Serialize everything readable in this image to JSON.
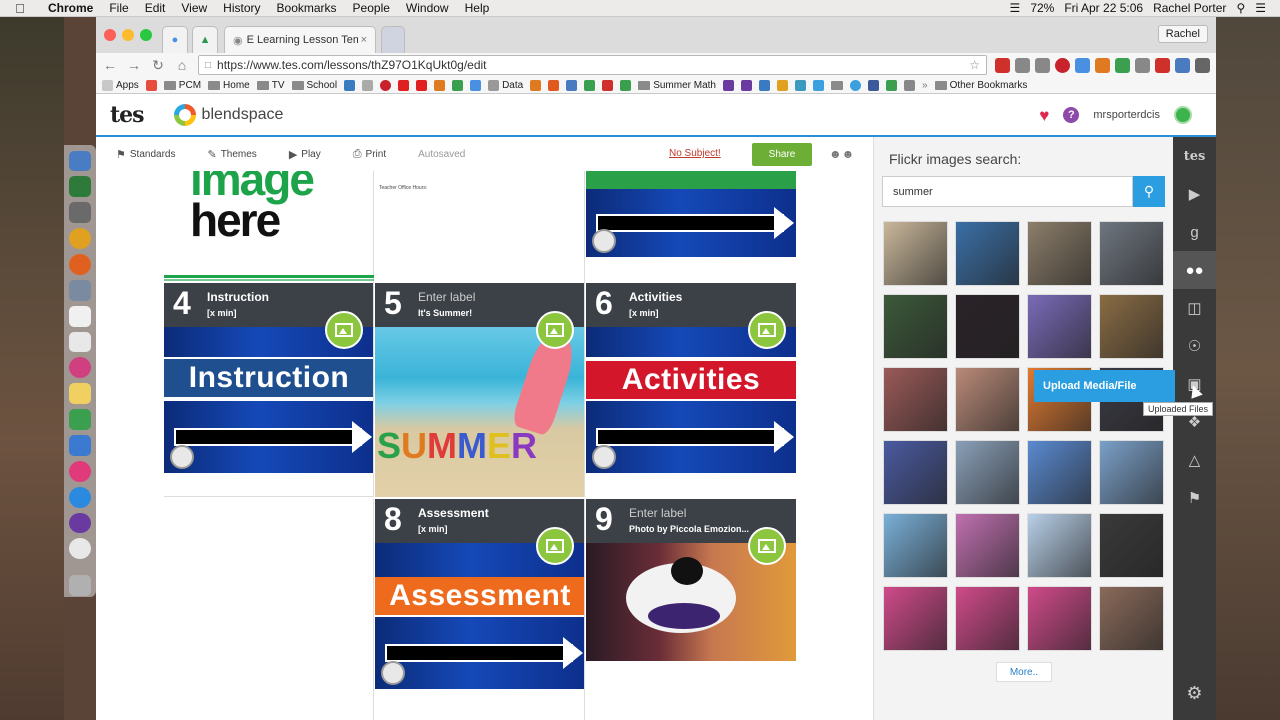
{
  "menubar": {
    "app_name": "Chrome",
    "items": [
      "File",
      "Edit",
      "View",
      "History",
      "Bookmarks",
      "People",
      "Window",
      "Help"
    ],
    "battery": "72%",
    "clock": "Fri Apr 22  5:06",
    "user": "Rachel Porter"
  },
  "browser": {
    "tab_title": "E Learning Lesson Templat",
    "profile": "Rachel",
    "url": "https://www.tes.com/lessons/thZ97O1KqUkt0g/edit",
    "bookmarks": [
      {
        "label": "Apps",
        "kind": "apps"
      },
      {
        "label": "PCM",
        "kind": "folder"
      },
      {
        "label": "Home",
        "kind": "folder"
      },
      {
        "label": "TV",
        "kind": "folder"
      },
      {
        "label": "School",
        "kind": "folder"
      },
      {
        "label": "Data",
        "kind": "site"
      },
      {
        "label": "Summer Math",
        "kind": "folder"
      },
      {
        "label": "Other Bookmarks",
        "kind": "folder"
      }
    ]
  },
  "tes": {
    "logo": "tes",
    "product": "blendspace",
    "username": "mrsporterdcis"
  },
  "lesson_toolbar": {
    "standards": "Standards",
    "themes": "Themes",
    "play": "Play",
    "print": "Print",
    "status": "Autosaved",
    "subject_link": "No Subject!",
    "share": "Share"
  },
  "tiles": {
    "image_placeholder_text": [
      "image",
      "here"
    ],
    "doc_tile_line": "Teacher Office Hours:",
    "tile4": {
      "number": "4",
      "label": "Instruction",
      "sub": "[x min]",
      "banner": "Instruction"
    },
    "tile5": {
      "number": "5",
      "label": "Enter label",
      "sub": "It's Summer!",
      "photo_word": "SUMMER"
    },
    "tile6": {
      "number": "6",
      "label": "Activities",
      "sub": "[x min]",
      "banner": "Activities"
    },
    "tile8": {
      "number": "8",
      "label": "Assessment",
      "sub": "[x min]",
      "banner": "Assessment"
    },
    "tile9": {
      "number": "9",
      "label": "Enter label",
      "sub": "Photo by Piccola Emozion..."
    }
  },
  "flickr": {
    "title": "Flickr images search:",
    "query": "summer",
    "more": "More..",
    "thumb_colors": [
      "#c9b79a",
      "#3a6fa6",
      "#8c7e6a",
      "#6f7680",
      "#3c5a3a",
      "#2a2228",
      "#7a6ab8",
      "#8a6c44",
      "#9a5a58",
      "#b98a78",
      "#e07a30",
      "#3a3a44",
      "#4a5aa0",
      "#8aa0b8",
      "#5a8ad0",
      "#7aa0c8",
      "#7ab0d8",
      "#c070b0",
      "#b8d0e8",
      "#3a3a3a",
      "#d04a8a",
      "#d04a8a",
      "#d04a8a",
      "#8a6a5a"
    ]
  },
  "rail": {
    "upload_label": "Upload Media/File",
    "tooltip": "Uploaded Files"
  }
}
